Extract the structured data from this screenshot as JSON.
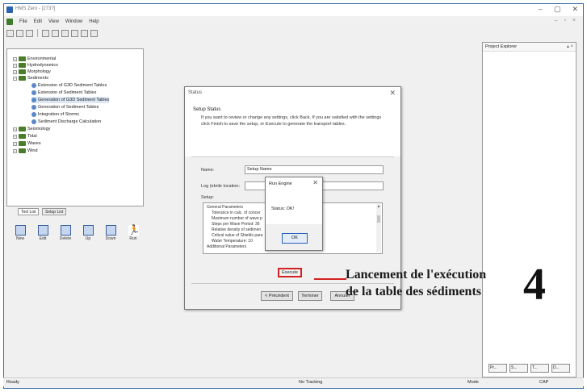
{
  "window": {
    "title": "HMS Zero - [273?]",
    "controls": [
      "–",
      "▢",
      "✕"
    ],
    "mdi_controls": "– ▫ ×"
  },
  "menu": [
    "File",
    "Edit",
    "View",
    "Window",
    "Help"
  ],
  "toolbar_icons": [
    "new-file-icon",
    "open-folder-icon",
    "save-icon",
    "cut-icon",
    "copy-icon",
    "paste-icon",
    "print-icon",
    "help-icon",
    "context-help-icon"
  ],
  "tree": [
    {
      "label": "Environmental",
      "type": "folder",
      "level": 0
    },
    {
      "label": "Hydrodynamics",
      "type": "folder",
      "level": 0
    },
    {
      "label": "Morphology",
      "type": "folder",
      "level": 0
    },
    {
      "label": "Sediments",
      "type": "folder",
      "level": 0
    },
    {
      "label": "Extension of G3D Sediment Tables",
      "type": "leaf",
      "level": 1
    },
    {
      "label": "Extension of Sediment Tables",
      "type": "leaf",
      "level": 1
    },
    {
      "label": "Generation of G3D Sediment Tables",
      "type": "leaf",
      "level": 1,
      "selected": true
    },
    {
      "label": "Generation of Sediment Tables",
      "type": "leaf",
      "level": 1
    },
    {
      "label": "Integration of Storms",
      "type": "leaf",
      "level": 1
    },
    {
      "label": "Sediment Discharge Calculation",
      "type": "leaf",
      "level": 1
    },
    {
      "label": "Seismology",
      "type": "folder",
      "level": 0
    },
    {
      "label": "Tidal",
      "type": "folder",
      "level": 0
    },
    {
      "label": "Waves",
      "type": "folder",
      "level": 0
    },
    {
      "label": "Wind",
      "type": "folder",
      "level": 0
    }
  ],
  "tabs": [
    "Tool List",
    "Setup List"
  ],
  "tools": [
    {
      "label": "New",
      "icon": "new-icon"
    },
    {
      "label": "Edit",
      "icon": "edit-icon"
    },
    {
      "label": "Delete",
      "icon": "delete-icon"
    },
    {
      "label": "Up",
      "icon": "up-icon"
    },
    {
      "label": "Down",
      "icon": "down-icon"
    },
    {
      "label": "Run",
      "icon": "run-icon"
    }
  ],
  "project_explorer": {
    "title": "Project Explorer",
    "controls": "▴ ×",
    "bottom_tabs": [
      "Pr...",
      "S...",
      "T...",
      "D..."
    ]
  },
  "status": {
    "ready": "Ready",
    "tracking": "No Tracking",
    "mode": "Mode",
    "cap": "CAP"
  },
  "dialog": {
    "title": "Status",
    "close": "✕",
    "heading": "Setup Status",
    "description": "If you want to review or change any settings, click Back. If you are satisfied with the settings click Finish to save the setup, or Execute to generate the transport tables.",
    "name_label": "Name:",
    "name_value": "Setup Name",
    "log_label": "Log (ebrile location:",
    "log_value": "",
    "setup_label": "Setup:",
    "setup_lines": [
      "General Parameters",
      "Tolerance in calc. of concer",
      "Maximum number of wave p",
      "Steps per Wave Period: 36",
      "Relative density of sedimen",
      "Critical value of Shields para",
      "Water Temperature: 10",
      "Additional Parameters"
    ],
    "execute_label": "Execute",
    "back_label": "< Précédent",
    "finish_label": "Terminer",
    "cancel_label": "Annuler"
  },
  "run_engine": {
    "title": "Run Engine",
    "close": "✕",
    "message": "Status: OK!",
    "ok_label": "OK"
  },
  "annotation": {
    "callout_line1": "Lancement de l'exécution",
    "callout_line2": "de la table des sédiments",
    "step_number": "4",
    "accent_color": "#d42020"
  }
}
